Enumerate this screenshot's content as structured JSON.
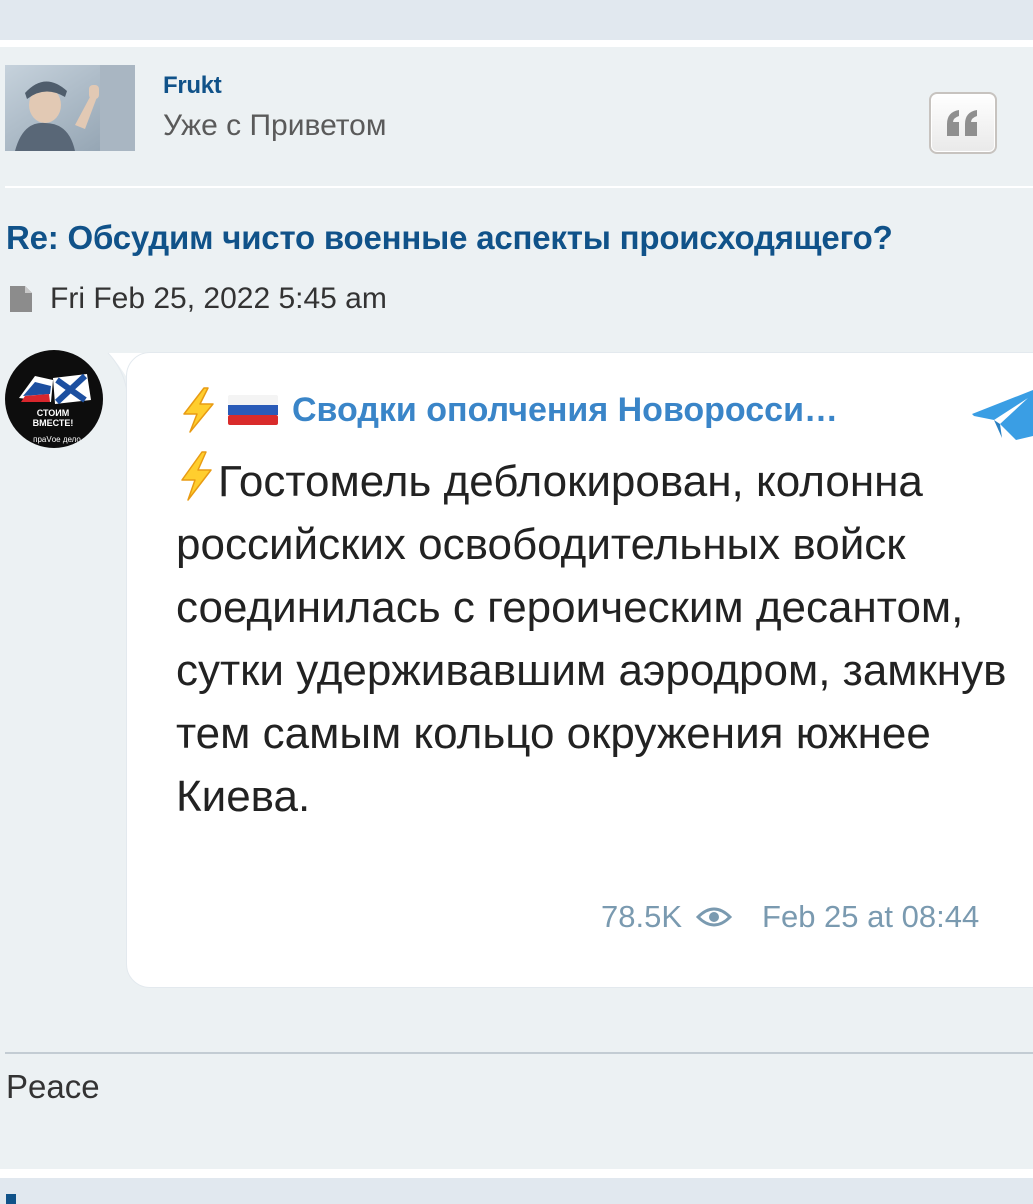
{
  "post": {
    "author": {
      "username": "Frukt",
      "rank": "Уже с Приветом"
    },
    "title": "Re: Обсудим чисто военные аспекты происходящего?",
    "timestamp": "Fri Feb 25, 2022 5:45 am",
    "signature": "Peace"
  },
  "telegram_embed": {
    "channel_name": "Сводки ополчения Новоросси…",
    "message": "Гостомель деблокирован, колонна российских освободительных войск соединилась с героическим десантом, сутки удерживавшим аэродром, замкнув тем самым кольцо окружения южнее Киева.",
    "views": "78.5K",
    "date": "Feb 25 at 08:44",
    "avatar_text": {
      "line1": "СТОИМ",
      "line2": "ВМЕСТЕ!",
      "line3": "праVое дело"
    }
  },
  "icons": {
    "quote": "quote-icon",
    "post": "document-icon",
    "views": "eye-icon",
    "platform": "telegram-icon",
    "channel_prefix": "lightning-icon",
    "flag": "russian-flag-icon"
  },
  "colors": {
    "link": "#105289",
    "telegram_blue": "#3a85c8",
    "card_bg": "#ecf1f3",
    "band_bg": "#e1e8ef"
  }
}
